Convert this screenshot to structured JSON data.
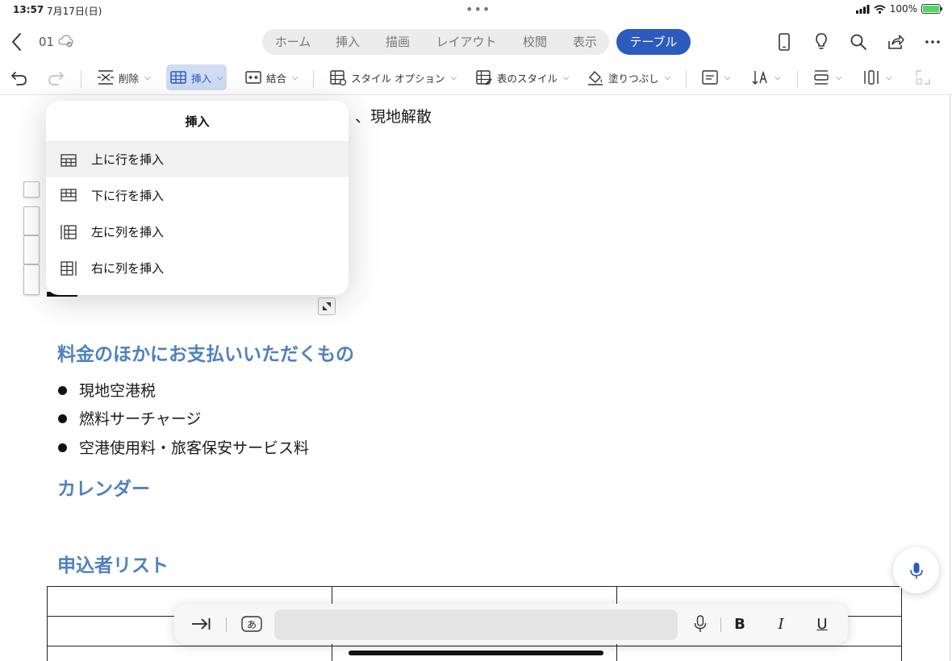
{
  "status": {
    "time": "13:57",
    "date": "7月17日(日)",
    "battery": "100%"
  },
  "header": {
    "doc_name": "01"
  },
  "tabs": [
    "ホーム",
    "挿入",
    "描画",
    "レイアウト",
    "校閲",
    "表示"
  ],
  "active_tab": "テーブル",
  "ribbon": {
    "delete": "削除",
    "insert": "挿入",
    "merge": "結合",
    "style_options": "スタイル オプション",
    "table_style": "表のスタイル",
    "fill": "塗りつぶし"
  },
  "menu": {
    "title": "挿入",
    "items": [
      "上に行を挿入",
      "下に行を挿入",
      "左に列を挿入",
      "右に列を挿入"
    ]
  },
  "document": {
    "partial_text": "、現地解散",
    "heading_payments": "料金のほかにお支払いいただくもの",
    "payment_items": [
      "現地空港税",
      "燃料サーチャージ",
      "空港使用料・旅客保安サービス料"
    ],
    "heading_calendar": "カレンダー",
    "heading_applicants": "申込者リスト"
  },
  "floating_bar": {
    "kana_key": "あ",
    "bold": "B",
    "italic": "I",
    "underline": "U"
  },
  "colors": {
    "accent": "#2c5bbd",
    "heading": "#4f81bd"
  }
}
